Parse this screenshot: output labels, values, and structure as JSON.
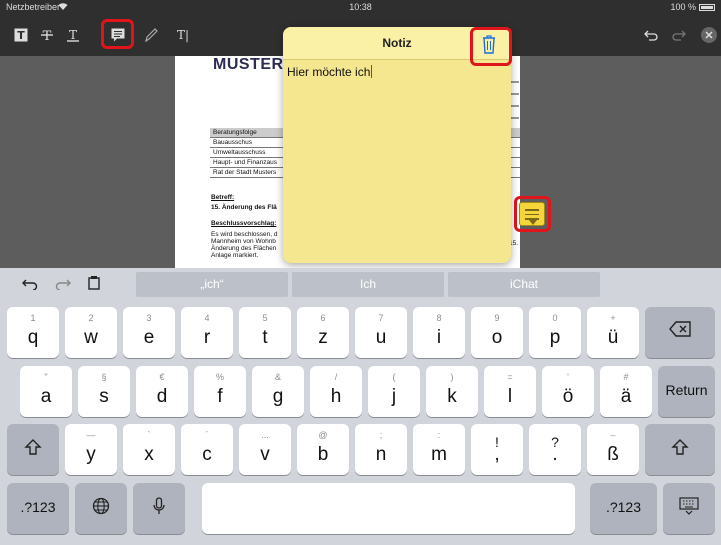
{
  "status": {
    "carrier": "Netzbetreiber",
    "time": "10:38",
    "battery": "100 %"
  },
  "toolbar": {
    "tools": [
      "text-bold-tool",
      "strikethrough-tool",
      "underline-tool",
      "note-tool",
      "pen-tool",
      "textbox-tool",
      "undo",
      "redo",
      "close"
    ],
    "textbox_label": "T|"
  },
  "document": {
    "heading": "MUSTERS",
    "table_rows": [
      "Beratungsfolge",
      "Bauausschus",
      "Umweltausschuss",
      "Haupt- und Finanzaus",
      "Rat der Stadt Musters"
    ],
    "betreff_label": "Betreff:",
    "betreff_text": "15. Änderung des Flä",
    "beschluss_label": "Beschlussvorschlag:",
    "body_lines": [
      "Es wird beschlossen, d",
      "Mannheim von Wohnb",
      "Änderung des Flächen",
      "Anlage markiert."
    ],
    "side_number": "15."
  },
  "note": {
    "title": "Notiz",
    "text": "Hier möchte ich"
  },
  "keyboard": {
    "suggestions": [
      "„ich“",
      "Ich",
      "iChat"
    ],
    "row1": [
      {
        "sec": "1",
        "pri": "q"
      },
      {
        "sec": "2",
        "pri": "w"
      },
      {
        "sec": "3",
        "pri": "e"
      },
      {
        "sec": "4",
        "pri": "r"
      },
      {
        "sec": "5",
        "pri": "t"
      },
      {
        "sec": "6",
        "pri": "z"
      },
      {
        "sec": "7",
        "pri": "u"
      },
      {
        "sec": "8",
        "pri": "i"
      },
      {
        "sec": "9",
        "pri": "o"
      },
      {
        "sec": "0",
        "pri": "p"
      },
      {
        "sec": "+",
        "pri": "ü"
      }
    ],
    "row2": [
      {
        "sec": "\"",
        "pri": "a"
      },
      {
        "sec": "§",
        "pri": "s"
      },
      {
        "sec": "€",
        "pri": "d"
      },
      {
        "sec": "%",
        "pri": "f"
      },
      {
        "sec": "&",
        "pri": "g"
      },
      {
        "sec": "/",
        "pri": "h"
      },
      {
        "sec": "(",
        "pri": "j"
      },
      {
        "sec": ")",
        "pri": "k"
      },
      {
        "sec": "=",
        "pri": "l"
      },
      {
        "sec": "'",
        "pri": "ö"
      },
      {
        "sec": "#",
        "pri": "ä"
      }
    ],
    "row3": [
      {
        "sec": "—",
        "pri": "y"
      },
      {
        "sec": "`",
        "pri": "x"
      },
      {
        "sec": "´",
        "pri": "c"
      },
      {
        "sec": "...",
        "pri": "v"
      },
      {
        "sec": "@",
        "pri": "b"
      },
      {
        "sec": ";",
        "pri": "n"
      },
      {
        "sec": ":",
        "pri": "m"
      },
      {
        "sec": "!",
        "pri": ","
      },
      {
        "sec": "?",
        "pri": "."
      },
      {
        "sec": "–",
        "pri": "ß"
      }
    ],
    "return_label": "Return",
    "numbers_label": ".?123"
  }
}
